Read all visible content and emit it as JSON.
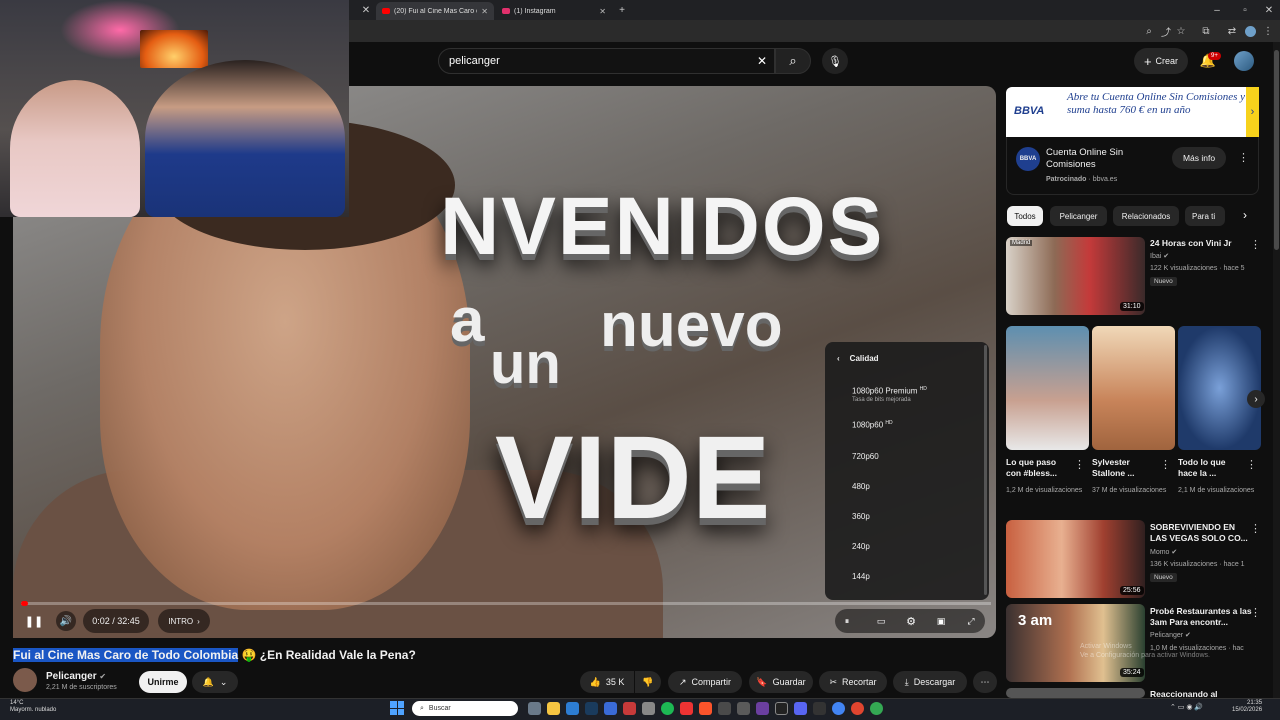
{
  "browser": {
    "tabs": [
      {
        "label": "(20) Fui al Cine Mas Caro d",
        "active": true,
        "color": "#ff0000"
      },
      {
        "label": "(1) Instagram",
        "active": false,
        "color": "#e1306c"
      }
    ],
    "new_tab_label": "+"
  },
  "header": {
    "search_value": "pelicanger",
    "create_label": "Crear",
    "notif_badge": "9+"
  },
  "video_overlay_text": {
    "line1": "NVENIDOS",
    "line2": "a",
    "line3": "nuevo",
    "line4": "un",
    "line5": "VIDE"
  },
  "player": {
    "time": "0:02 / 32:45",
    "chapter": "INTRO",
    "progress_fraction": 0.001
  },
  "quality_menu": {
    "title": "Calidad",
    "options": [
      {
        "label": "1080p60 Premium",
        "badge": "HD",
        "sub": "Tasa de bits mejorada"
      },
      {
        "label": "1080p60",
        "badge": "HD",
        "sub": ""
      },
      {
        "label": "720p60",
        "badge": "",
        "sub": ""
      },
      {
        "label": "480p",
        "badge": "",
        "sub": ""
      },
      {
        "label": "360p",
        "badge": "",
        "sub": ""
      },
      {
        "label": "240p",
        "badge": "",
        "sub": ""
      },
      {
        "label": "144p",
        "badge": "",
        "sub": ""
      }
    ]
  },
  "video_info": {
    "title_highlight": "Fui al Cine Mas Caro de Todo Colombia",
    "title_rest": " 🤑 ¿En Realidad Vale la Pena?",
    "channel": "Pelicanger",
    "subscribers": "2,21 M de suscriptores",
    "join_label": "Unirme",
    "likes": "35 K",
    "share_label": "Compartir",
    "save_label": "Guardar",
    "clip_label": "Recortar",
    "download_label": "Descargar"
  },
  "ad": {
    "banner_text": "Abre tu Cuenta Online Sin Comisiones y suma hasta 760 € en un año",
    "brand": "BBVA",
    "title": "Cuenta Online Sin Comisiones",
    "sponsored": "Patrocinado",
    "domain": "bbva.es",
    "cta": "Más info"
  },
  "chips": [
    "Todos",
    "Pelicanger",
    "Relacionados",
    "Para ti"
  ],
  "sidebar_videos": [
    {
      "title": "24 Horas con Vini Jr",
      "channel": "Ibai",
      "meta": "122 K visualizaciones · hace 5",
      "duration": "31:10",
      "badge": "Nuevo"
    },
    {
      "title": "SOBREVIVIENDO EN LAS VEGAS SOLO CO...",
      "channel": "Momo",
      "meta": "136 K visualizaciones · hace 1",
      "duration": "25:56",
      "badge": "Nuevo"
    },
    {
      "title": "Probé Restaurantes a las 3am Para encontr...",
      "channel": "Pelicanger",
      "meta": "1,0 M de visualizaciones · hac",
      "duration": "35:24",
      "badge": ""
    },
    {
      "title": "Reaccionando al",
      "channel": "",
      "meta": "",
      "duration": "",
      "badge": ""
    }
  ],
  "shorts": [
    {
      "title": "Lo que paso con #bless...",
      "meta": "1,2 M de visualizaciones"
    },
    {
      "title": "Sylvester Stallone ...",
      "meta": "37 M de visualizaciones"
    },
    {
      "title": "Todo lo que hace la ...",
      "meta": "2,1 M de visualizaciones"
    }
  ],
  "thumb_text": {
    "threeam": "3 am",
    "madrid": "Madrid"
  },
  "windows_watermark": {
    "line1": "Activar Windows",
    "line2": "Ve a Configuración para activar Windows."
  },
  "taskbar": {
    "temp": "14°C",
    "weather": "Mayorm. nublado",
    "search_placeholder": "Buscar",
    "time": "21:35",
    "date": "15/02/2026"
  }
}
